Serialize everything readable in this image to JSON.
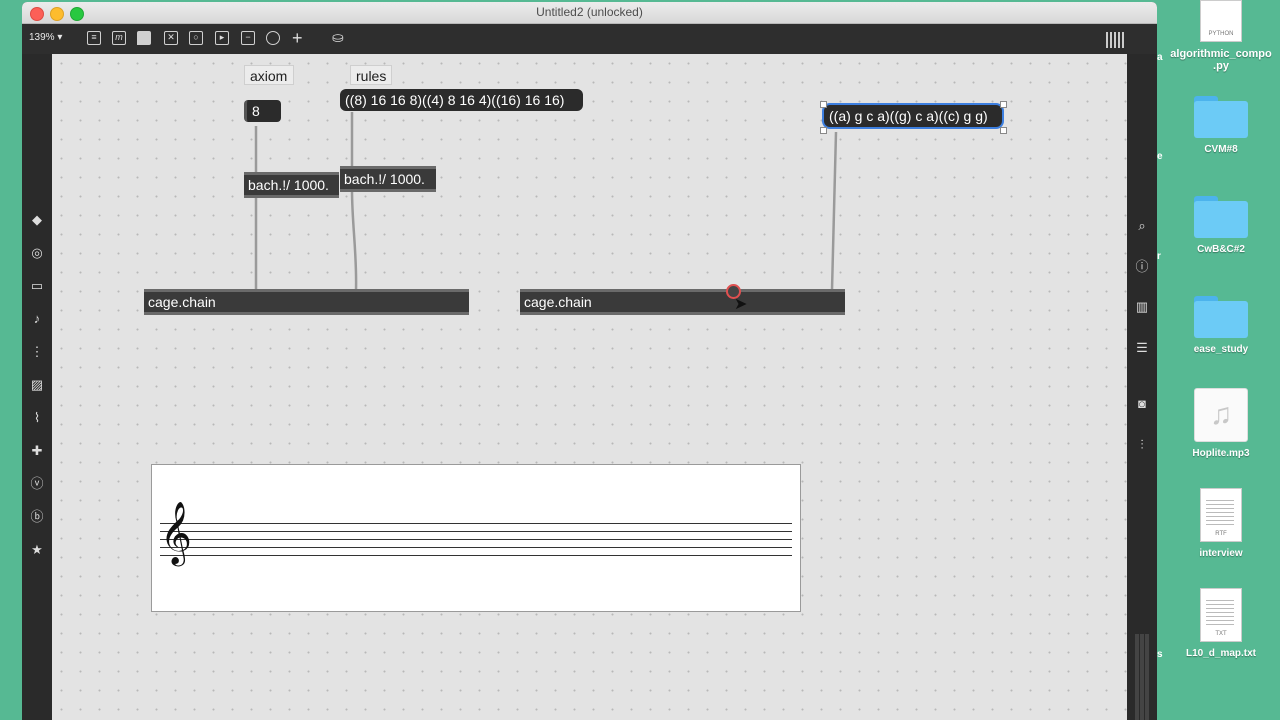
{
  "window": {
    "title": "Untitled2 (unlocked)"
  },
  "toolbar": {
    "zoom": "139%",
    "icons": [
      "patcher-icon",
      "message-icon",
      "comment-icon",
      "toggle-icon",
      "button-icon",
      "number-icon",
      "slider-icon",
      "dial-icon",
      "add-object-icon",
      "paint-bucket-icon",
      "grid-icon"
    ]
  },
  "patcher": {
    "comment_axiom": "axiom",
    "comment_rules": "rules",
    "number_value": "8",
    "rules_message": "((8) 16 16 8)((4) 8 16 4)((16) 16 16)",
    "selected_message": "((a) g c a)((g) c a)((c) g g)",
    "math_object_1": "bach.!/ 1000.",
    "math_object_2": "bach.!/ 1000.",
    "chain_object_1": "cage.chain",
    "chain_object_2": "cage.chain"
  },
  "desktop": {
    "files": [
      {
        "name": "algorithmic_compo\n.py",
        "kind": "python",
        "badge": "PYTHON"
      },
      {
        "name": "CVM#8",
        "kind": "folder"
      },
      {
        "name": "CwB&C#2",
        "kind": "folder"
      },
      {
        "name": "ease_study",
        "kind": "folder"
      },
      {
        "name": "Hoplite.mp3",
        "kind": "audio"
      },
      {
        "name": "interview",
        "kind": "document",
        "badge": "RTF"
      },
      {
        "name": "L10_d_map.txt",
        "kind": "document",
        "badge": "TXT"
      }
    ],
    "partial_labels": [
      "a",
      "e",
      "r",
      "s"
    ]
  },
  "colors": {
    "selection": "#3d7fe0",
    "canvas": "#e3e3e3",
    "patch_cord": "#9a9a9a",
    "highlight_inlet": "#e05050"
  }
}
